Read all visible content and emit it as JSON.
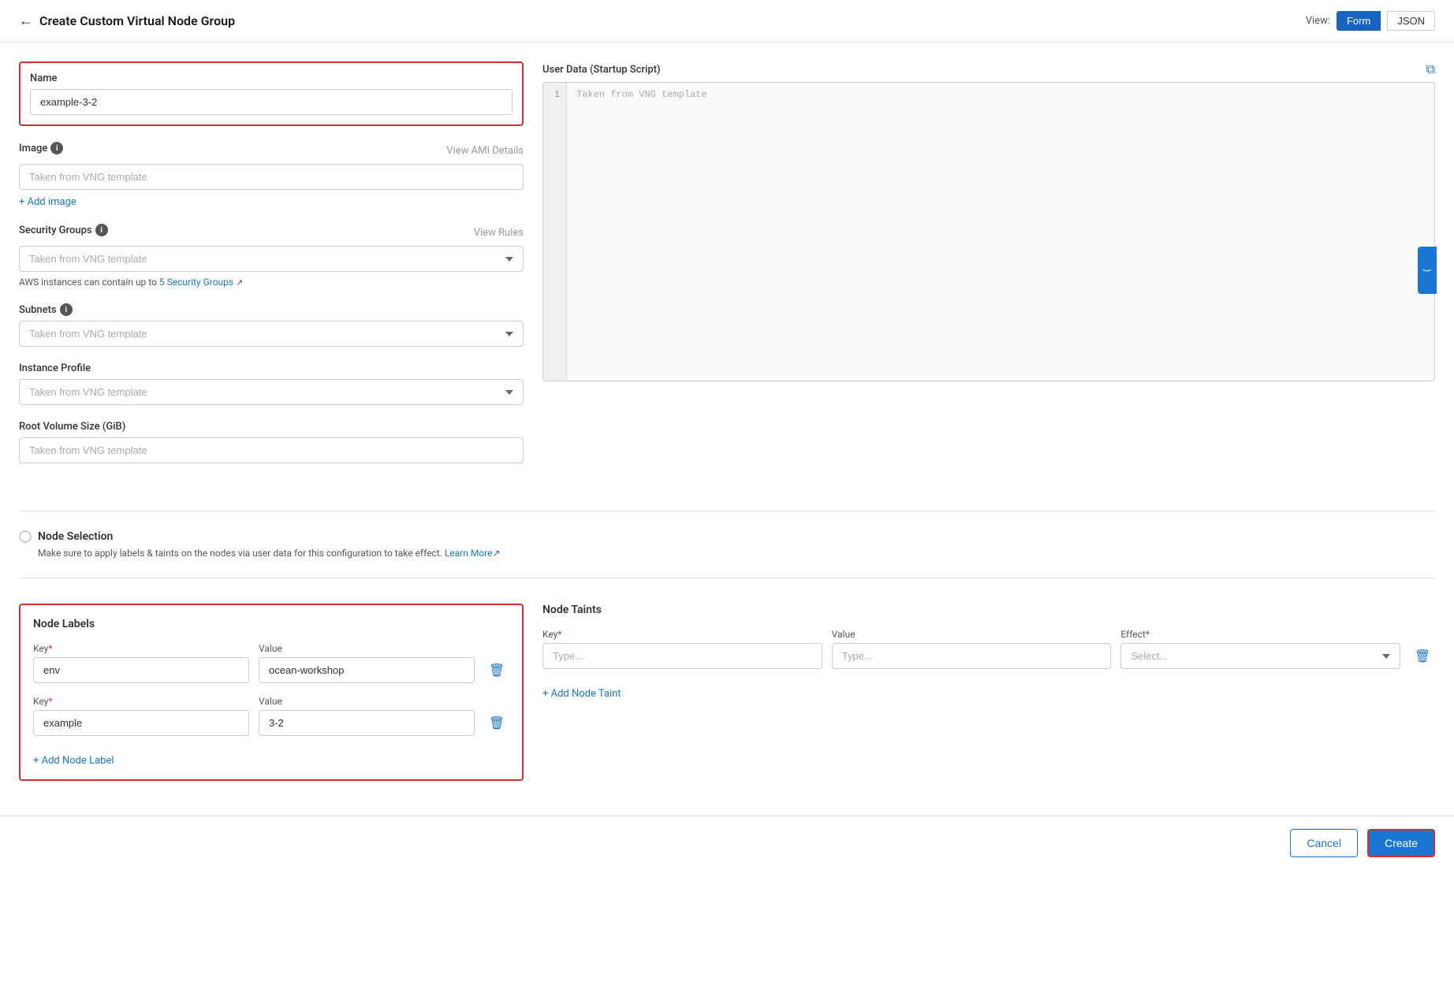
{
  "header": {
    "title": "Create Custom Virtual Node Group",
    "back_label": "←",
    "view_label": "View:",
    "view_form": "Form",
    "view_json": "JSON"
  },
  "form": {
    "name_label": "Name",
    "name_value": "example-3-2",
    "image_label": "Image",
    "image_info": "i",
    "image_placeholder": "Taken from VNG template",
    "view_ami_details": "View AMI Details",
    "add_image": "+ Add image",
    "security_groups_label": "Security Groups",
    "security_groups_info": "i",
    "view_rules": "View Rules",
    "security_groups_placeholder": "Taken from VNG template",
    "security_note_prefix": "AWS instances can contain up to ",
    "security_note_count": "5",
    "security_note_link": "Security Groups",
    "security_note_ext": "↗",
    "subnets_label": "Subnets",
    "subnets_info": "i",
    "subnets_placeholder": "Taken from VNG template",
    "instance_profile_label": "Instance Profile",
    "instance_profile_placeholder": "Taken from VNG template",
    "root_volume_label": "Root Volume Size (GiB)",
    "root_volume_placeholder": "Taken from VNG template"
  },
  "user_data": {
    "label": "User Data (Startup Script)",
    "copy_title": "Copy",
    "line_number": "1",
    "placeholder": "Taken from VNG template"
  },
  "node_selection": {
    "title": "Node Selection",
    "description": "Make sure to apply labels & taints on the nodes via user data for this configuration to take effect.",
    "learn_more": "Learn More",
    "learn_more_ext": "↗"
  },
  "node_labels": {
    "title": "Node Labels",
    "key_label": "Key",
    "value_label": "Value",
    "required_marker": "*",
    "rows": [
      {
        "key": "env",
        "value": "ocean-workshop"
      },
      {
        "key": "example",
        "value": "3-2"
      }
    ],
    "add_label": "+ Add Node Label"
  },
  "node_taints": {
    "title": "Node Taints",
    "key_label": "Key",
    "value_label": "Value",
    "effect_label": "Effect",
    "required_marker": "*",
    "key_placeholder": "Type...",
    "value_placeholder": "Type...",
    "effect_placeholder": "Select...",
    "add_taint": "+ Add Node Taint"
  },
  "footer": {
    "cancel_label": "Cancel",
    "create_label": "Create"
  }
}
